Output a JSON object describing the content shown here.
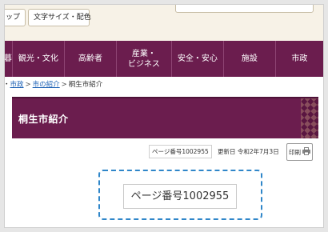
{
  "header": {
    "left_button_partial": "ップ",
    "font_button": "文字サイズ・配色"
  },
  "nav": {
    "items": [
      {
        "label": "暮"
      },
      {
        "label": "観光・文化"
      },
      {
        "label": "高齢者"
      },
      {
        "label": "産業・\nビジネス"
      },
      {
        "label": "安全・安心"
      },
      {
        "label": "施設"
      },
      {
        "label": "市政"
      }
    ]
  },
  "breadcrumb": {
    "lead": "・",
    "link1": "市政",
    "sep1": ">",
    "link2": "市の紹介",
    "sep2": ">",
    "current": "桐生市紹介"
  },
  "page": {
    "title": "桐生市紹介",
    "page_number": "ページ番号1002955",
    "updated": "更新日 令和2年7月3日",
    "print_label": "印刷"
  },
  "callout": {
    "zoom_text": "ページ番号1002955",
    "border_color": "#2f86c9"
  },
  "colors": {
    "brand": "#6b1d4e",
    "link": "#1a5fb4"
  }
}
